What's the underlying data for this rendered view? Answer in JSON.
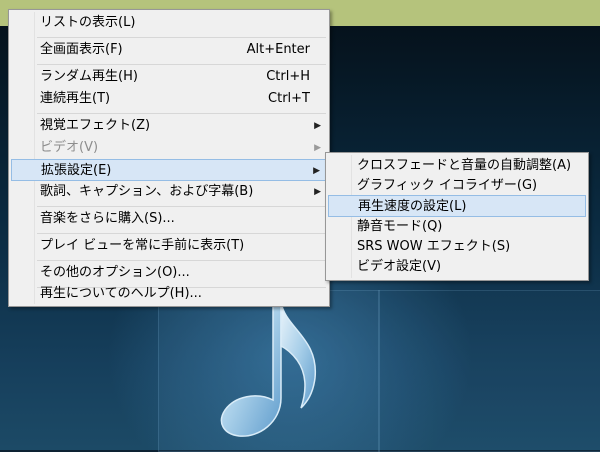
{
  "colors": {
    "top_strip": "#b5c37c",
    "menu_background": "#f0f0f0",
    "highlight_background": "#d7e6f6",
    "highlight_border": "#95bde5",
    "disabled_text": "#8d8d8d"
  },
  "background_icon": "music-note-icon",
  "main_menu": {
    "items": [
      {
        "label": "リストの表示(L)",
        "shortcut": ""
      },
      {
        "label": "全画面表示(F)",
        "shortcut": "Alt+Enter"
      },
      {
        "label": "ランダム再生(H)",
        "shortcut": "Ctrl+H"
      },
      {
        "label": "連続再生(T)",
        "shortcut": "Ctrl+T"
      },
      {
        "label": "視覚エフェクト(Z)",
        "submenu": true
      },
      {
        "label": "ビデオ(V)",
        "submenu": true,
        "disabled": true
      },
      {
        "label": "拡張設定(E)",
        "submenu": true,
        "highlighted": true
      },
      {
        "label": "歌詞、キャプション、および字幕(B)",
        "submenu": true
      },
      {
        "label": "音楽をさらに購入(S)..."
      },
      {
        "label": "プレイ ビューを常に手前に表示(T)"
      },
      {
        "label": "その他のオプション(O)..."
      },
      {
        "label": "再生についてのヘルプ(H)..."
      }
    ]
  },
  "sub_menu": {
    "items": [
      {
        "label": "クロスフェードと音量の自動調整(A)"
      },
      {
        "label": "グラフィック イコライザー(G)"
      },
      {
        "label": "再生速度の設定(L)",
        "highlighted": true
      },
      {
        "label": "静音モード(Q)"
      },
      {
        "label": "SRS WOW エフェクト(S)"
      },
      {
        "label": "ビデオ設定(V)"
      }
    ]
  }
}
